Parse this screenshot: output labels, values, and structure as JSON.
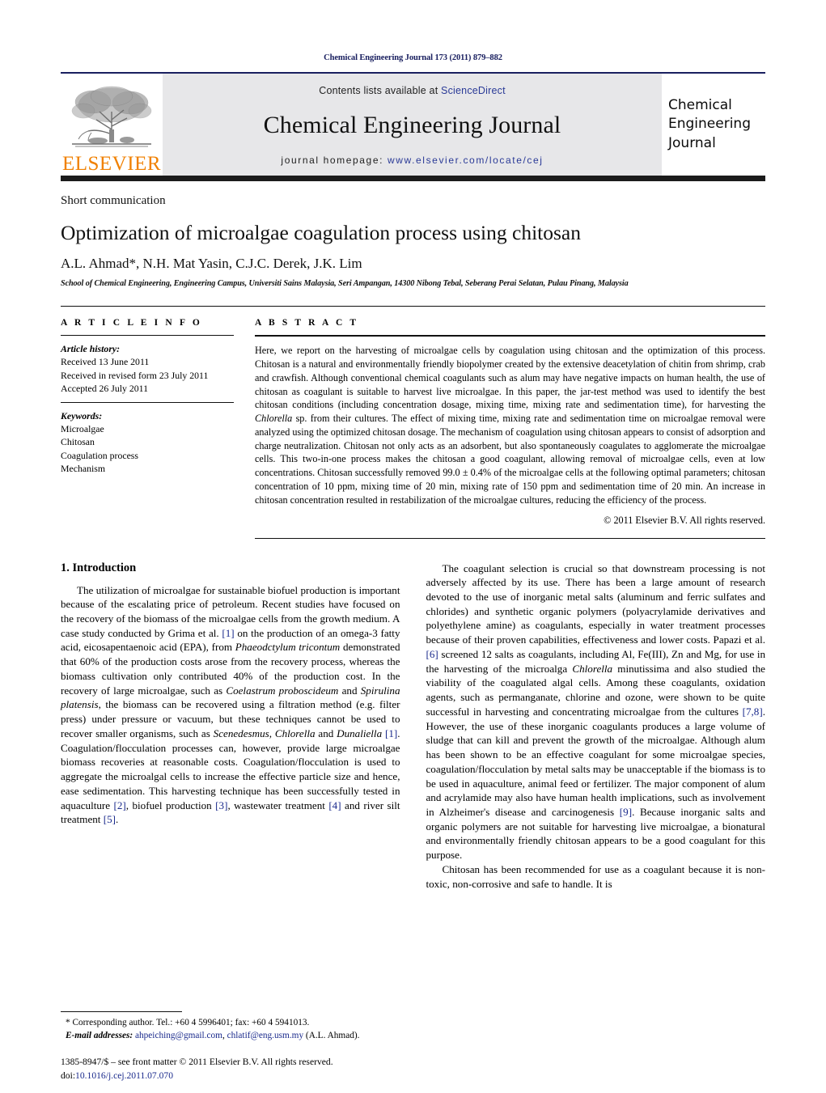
{
  "running_head": "Chemical Engineering Journal 173 (2011) 879–882",
  "masthead": {
    "publisher_logo_text": "ELSEVIER",
    "contents_prefix": "Contents lists available at ",
    "contents_link": "ScienceDirect",
    "journal_name": "Chemical Engineering Journal",
    "homepage_prefix": "journal homepage: ",
    "homepage_url": "www.elsevier.com/locate/cej",
    "cover_line1": "Chemical",
    "cover_line2": "Engineering",
    "cover_line3": "Journal",
    "accent_link_color": "#2a3a97",
    "elsevier_orange": "#f08000",
    "band_color": "#e7e7e9"
  },
  "article": {
    "doctype": "Short communication",
    "title": "Optimization of microalgae coagulation process using chitosan",
    "authors": "A.L. Ahmad*, N.H. Mat Yasin, C.J.C. Derek, J.K. Lim",
    "affiliation": "School of Chemical Engineering, Engineering Campus, Universiti Sains Malaysia, Seri Ampangan, 14300 Nibong Tebal, Seberang Perai Selatan, Pulau Pinang, Malaysia"
  },
  "article_info": {
    "label": "A R T I C L E  I N F O",
    "history_label": "Article history:",
    "history": [
      "Received 13 June 2011",
      "Received in revised form 23 July 2011",
      "Accepted 26 July 2011"
    ],
    "keywords_label": "Keywords:",
    "keywords": [
      "Microalgae",
      "Chitosan",
      "Coagulation process",
      "Mechanism"
    ]
  },
  "abstract": {
    "label": "A B S T R A C T",
    "text": "Here, we report on the harvesting of microalgae cells by coagulation using chitosan and the optimization of this process. Chitosan is a natural and environmentally friendly biopolymer created by the extensive deacetylation of chitin from shrimp, crab and crawfish. Although conventional chemical coagulants such as alum may have negative impacts on human health, the use of chitosan as coagulant is suitable to harvest live microalgae. In this paper, the jar-test method was used to identify the best chitosan conditions (including concentration dosage, mixing time, mixing rate and sedimentation time), for harvesting the ",
    "species_italic": "Chlorella",
    "text_after_species": " sp. from their cultures. The effect of mixing time, mixing rate and sedimentation time on microalgae removal were analyzed using the optimized chitosan dosage. The mechanism of coagulation using chitosan appears to consist of adsorption and charge neutralization. Chitosan not only acts as an adsorbent, but also spontaneously coagulates to agglomerate the microalgae cells. This two-in-one process makes the chitosan a good coagulant, allowing removal of microalgae cells, even at low concentrations. Chitosan successfully removed 99.0 ± 0.4% of the microalgae cells at the following optimal parameters; chitosan concentration of 10 ppm, mixing time of 20 min, mixing rate of 150 ppm and sedimentation time of 20 min. An increase in chitosan concentration resulted in restabilization of the microalgae cultures, reducing the efficiency of the process.",
    "copyright": "© 2011 Elsevier B.V. All rights reserved."
  },
  "introduction": {
    "heading": "1.  Introduction",
    "left_p1_a": "The utilization of microalgae for sustainable biofuel production is important because of the escalating price of petroleum. Recent studies have focused on the recovery of the biomass of the microalgae cells from the growth medium. A case study conducted by Grima et al. ",
    "left_p1_ref1": "[1]",
    "left_p1_b": " on the production of an omega-3 fatty acid, eicosapentaenoic acid (EPA), from ",
    "left_p1_sp1": "Phaeodctylum tricontum",
    "left_p1_c": " demonstrated that 60% of the production costs arose from the recovery process, whereas the biomass cultivation only contributed 40% of the production cost. In the recovery of large microalgae, such as ",
    "left_p1_sp2": "Coelastrum proboscideum",
    "left_p1_d": " and ",
    "left_p1_sp3": "Spirulina platensis",
    "left_p1_e": ", the biomass can be recovered using a filtration method (e.g. filter press) under pressure or vacuum, but these techniques cannot be used to recover smaller organisms, such as ",
    "left_p1_sp4": "Scenedesmus",
    "left_p1_f": ", ",
    "left_p1_sp5": "Chlorella",
    "left_p1_g": " and ",
    "left_p1_sp6": "Dunaliella",
    "left_p1_h": " ",
    "left_p1_ref2": "[1]",
    "left_p1_i": ". Coagulation/flocculation processes can, however, provide large microalgae biomass recoveries at reasonable costs. Coagulation/flocculation is used to aggregate the microalgal cells to increase the effective particle size and hence, ease sedimentation. This harvesting technique has been successfully tested in aquaculture ",
    "left_p1_ref3": "[2]",
    "left_p1_j": ", biofuel production ",
    "left_p1_ref4": "[3]",
    "left_p1_k": ", wastewater treatment ",
    "left_p1_ref5": "[4]",
    "left_p1_l": " and river silt treatment ",
    "left_p1_ref6": "[5]",
    "left_p1_m": ".",
    "right_p1_a": "The coagulant selection is crucial so that downstream processing is not adversely affected by its use. There has been a large amount of research devoted to the use of inorganic metal salts (aluminum and ferric sulfates and chlorides) and synthetic organic polymers (polyacrylamide derivatives and polyethylene amine) as coagulants, especially in water treatment processes because of their proven capabilities, effectiveness and lower costs. Papazi et al. ",
    "right_p1_ref1": "[6]",
    "right_p1_b": " screened 12 salts as coagulants, including Al, Fe(III), Zn and Mg, for use in the harvesting of the microalga ",
    "right_p1_sp1": "Chlorella",
    "right_p1_c": " minutissima and also studied the viability of the coagulated algal cells. Among these coagulants, oxidation agents, such as permanganate, chlorine and ozone, were shown to be quite successful in harvesting and concentrating microalgae from the cultures ",
    "right_p1_ref2": "[7,8]",
    "right_p1_d": ". However, the use of these inorganic coagulants produces a large volume of sludge that can kill and prevent the growth of the microalgae. Although alum has been shown to be an effective coagulant for some microalgae species, coagulation/flocculation by metal salts may be unacceptable if the biomass is to be used in aquaculture, animal feed or fertilizer. The major component of alum and acrylamide may also have human health implications, such as involvement in Alzheimer's disease and carcinogenesis ",
    "right_p1_ref3": "[9]",
    "right_p1_e": ". Because inorganic salts and organic polymers are not suitable for harvesting live microalgae, a bionatural and environmentally friendly chitosan appears to be a good coagulant for this purpose.",
    "right_p2": "Chitosan has been recommended for use as a coagulant because it is non-toxic, non-corrosive and safe to handle. It is"
  },
  "footnote": {
    "corresponding": "* Corresponding author. Tel.: +60 4 5996401; fax: +60 4 5941013.",
    "email_label": "E-mail addresses:",
    "email1": "ahpeiching@gmail.com",
    "email_sep": ", ",
    "email2": "chlatif@eng.usm.my",
    "email_attrib": " (A.L. Ahmad).",
    "issn_line": "1385-8947/$ – see front matter © 2011 Elsevier B.V. All rights reserved.",
    "doi_label": "doi:",
    "doi_value": "10.1016/j.cej.2011.07.070"
  }
}
